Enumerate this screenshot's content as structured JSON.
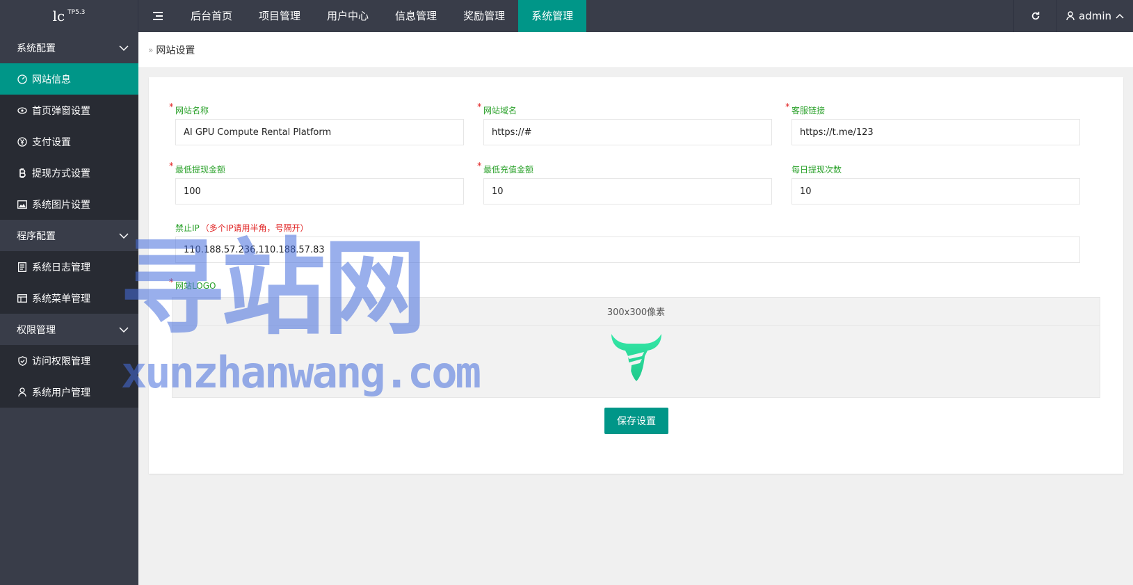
{
  "header": {
    "logo_text": "lc",
    "logo_sup": "TP5.3",
    "nav": [
      {
        "label": "后台首页"
      },
      {
        "label": "项目管理"
      },
      {
        "label": "用户中心"
      },
      {
        "label": "信息管理"
      },
      {
        "label": "奖励管理"
      },
      {
        "label": "系统管理"
      }
    ],
    "active_nav": "系统管理",
    "user": "admin"
  },
  "sidebar": {
    "groups": [
      {
        "label": "系统配置",
        "items": [
          {
            "label": "网站信息",
            "icon": "gauge-icon",
            "active": true
          },
          {
            "label": "首页弹窗设置",
            "icon": "eye-icon"
          },
          {
            "label": "支付设置",
            "icon": "yen-icon"
          },
          {
            "label": "提现方式设置",
            "icon": "bitcoin-icon"
          },
          {
            "label": "系统图片设置",
            "icon": "image-icon"
          }
        ]
      },
      {
        "label": "程序配置",
        "items": [
          {
            "label": "系统日志管理",
            "icon": "document-icon"
          },
          {
            "label": "系统菜单管理",
            "icon": "table-icon"
          }
        ]
      },
      {
        "label": "权限管理",
        "items": [
          {
            "label": "访问权限管理",
            "icon": "shield-icon"
          },
          {
            "label": "系统用户管理",
            "icon": "user-icon"
          }
        ]
      }
    ]
  },
  "breadcrumb": {
    "current": "网站设置"
  },
  "form": {
    "site_name": {
      "label": "网站名称",
      "value": "AI GPU Compute Rental Platform"
    },
    "site_domain": {
      "label": "网站域名",
      "value": "https://#"
    },
    "service_link": {
      "label": "客服链接",
      "value": "https://t.me/123"
    },
    "min_withdraw": {
      "label": "最低提现金额",
      "value": "100"
    },
    "min_recharge": {
      "label": "最低充值金额",
      "value": "10"
    },
    "daily_withdraw": {
      "label": "每日提现次数",
      "value": "10"
    },
    "banned_ip": {
      "label": "禁止IP",
      "hint": "（多个IP请用半角，号隔开）",
      "value": "110.188.57.236,110.188.57.83"
    },
    "logo": {
      "label": "网站LOGO",
      "size_hint": "300x300像素"
    },
    "save_label": "保存设置"
  },
  "watermark": {
    "cn": "寻站网",
    "en": "xunzhanwang.com"
  },
  "colors": {
    "accent": "#009688",
    "dark": "#393d49",
    "darker": "#282b33",
    "label_green": "#2aa12a",
    "required_red": "#e02020"
  }
}
